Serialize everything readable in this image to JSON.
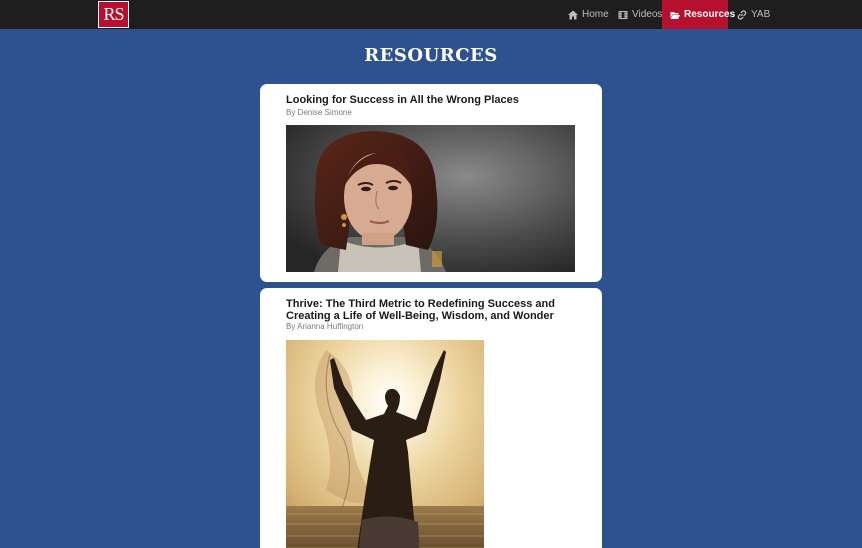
{
  "brand": {
    "logo_text": "RS",
    "accent": "#b5112e",
    "background": "#2d528f"
  },
  "nav": {
    "items": [
      {
        "label": "Home",
        "icon": "home-icon"
      },
      {
        "label": "Videos",
        "icon": "film-icon"
      },
      {
        "label": "Resources",
        "icon": "folder-open-icon",
        "active": true
      },
      {
        "label": "YAB",
        "icon": "link-icon"
      }
    ]
  },
  "page": {
    "title": "RESOURCES"
  },
  "resources": [
    {
      "title": "Looking for Success in All the Wrong Places",
      "author": "By Denise Simone",
      "image": "portrait-photo"
    },
    {
      "title": "Thrive: The Third Metric to Redefining Success and Creating a Life of Well-Being, Wisdom, and Wonder",
      "author": "By Arianna Huffington",
      "image": "sunset-photo"
    }
  ]
}
